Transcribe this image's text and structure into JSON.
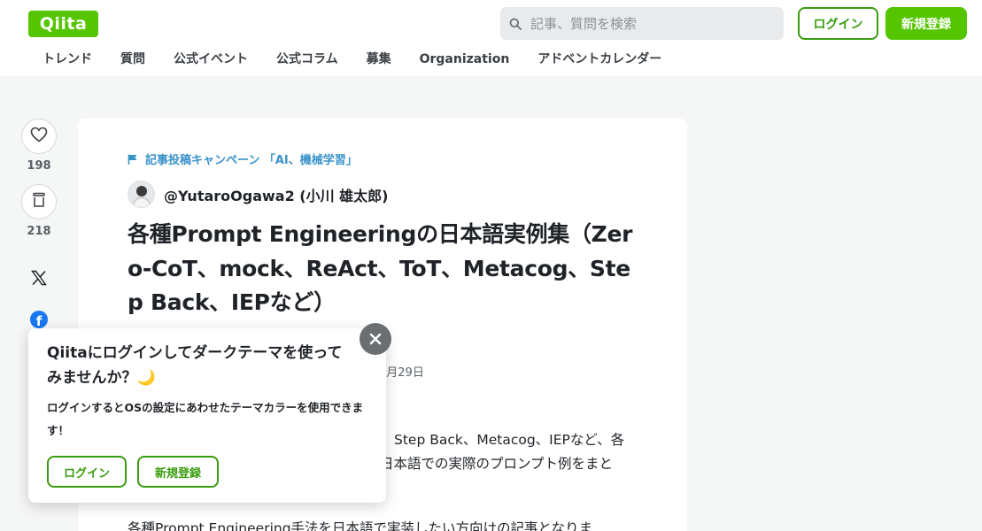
{
  "header": {
    "logo": "Qiita",
    "search_placeholder": "記事、質問を検索",
    "login_label": "ログイン",
    "signup_label": "新規登録"
  },
  "nav": [
    "トレンド",
    "質問",
    "公式イベント",
    "公式コラム",
    "募集",
    "Organization",
    "アドベントカレンダー"
  ],
  "side": {
    "like_count": "198",
    "stock_count": "218",
    "icons": [
      "heart-icon",
      "stock-icon",
      "x-icon",
      "facebook-icon",
      "hatena-bookmark-icon",
      "more-icon"
    ]
  },
  "article": {
    "campaign": "記事投稿キャンペーン 「AI、機械学習」",
    "author": "@YutaroOgawa2 (小川 雄太郎)",
    "title": "各種Prompt Engineeringの日本語実例集（Zero-CoT、mock、ReAct、ToT、Metacog、Step Back、IEPなど）",
    "date_fragment": "0月29日",
    "body_line1": "Step Back、Metacog、IEPなど、各",
    "body_line2": "日本語での実際のプロンプト例をまと",
    "body_line3": "各種Prompt Engineering手法を日本語で実装したい方向けの記事となりま"
  },
  "popup": {
    "title": "Qiitaにログインしてダークテーマを使ってみませんか？🌙",
    "description": "ログインするとOSの設定にあわせたテーマカラーを使用できます！",
    "login_label": "ログイン",
    "signup_label": "新規登録"
  },
  "colors": {
    "brand_green": "#55c500",
    "button_green": "#3a9d10",
    "campaign_blue": "#3a93c9",
    "facebook_blue": "#1877f2",
    "hatena_blue": "#00a4de"
  }
}
